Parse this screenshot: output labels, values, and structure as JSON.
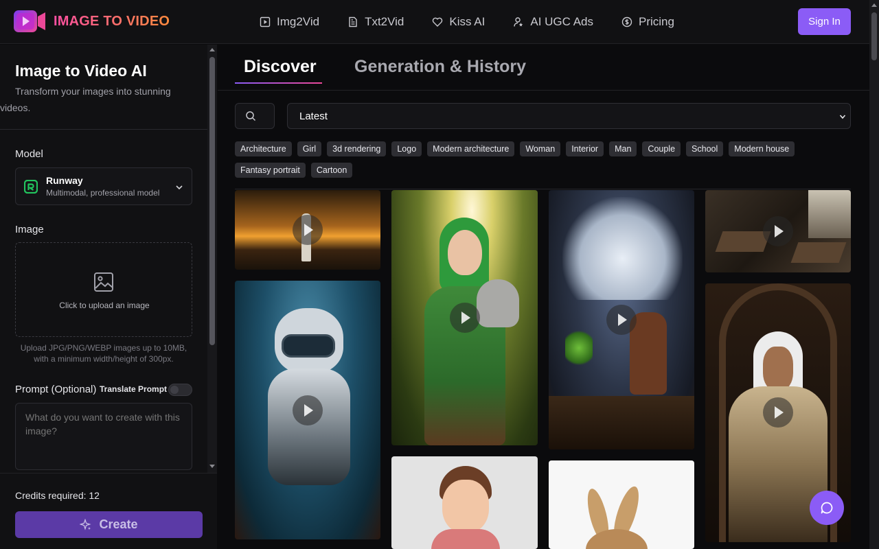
{
  "brand": {
    "name": "IMAGE TO VIDEO"
  },
  "nav": {
    "items": [
      {
        "label": "Img2Vid",
        "icon": "play-square-icon"
      },
      {
        "label": "Txt2Vid",
        "icon": "document-icon"
      },
      {
        "label": "Kiss AI",
        "icon": "heart-icon"
      },
      {
        "label": "AI UGC Ads",
        "icon": "user-star-icon"
      },
      {
        "label": "Pricing",
        "icon": "dollar-circle-icon"
      }
    ],
    "signin_label": "Sign In"
  },
  "sidebar": {
    "title": "Image to Video AI",
    "subtitle": "Transform your images into stunning videos.",
    "model_label": "Model",
    "model": {
      "name": "Runway",
      "description": "Multimodal, professional model"
    },
    "image_label": "Image",
    "upload_text": "Click to upload an image",
    "upload_hint": "Upload JPG/PNG/WEBP images up to 10MB, with a minimum width/height of 300px.",
    "prompt_label": "Prompt (Optional)",
    "translate_label": "Translate Prompt",
    "translate_on": false,
    "prompt_placeholder": "What do you want to create with this image?",
    "credits_text": "Credits required: 12",
    "create_label": "Create"
  },
  "main": {
    "tabs": [
      {
        "label": "Discover",
        "active": true
      },
      {
        "label": "Generation & History",
        "active": false
      }
    ],
    "sort_value": "Latest",
    "tags": [
      "Architecture",
      "Girl",
      "3d rendering",
      "Logo",
      "Modern architecture",
      "Woman",
      "Interior",
      "Man",
      "Couple",
      "School",
      "Modern house",
      "Fantasy portrait",
      "Cartoon"
    ]
  },
  "colors": {
    "accent": "#8b5cf6",
    "brand_gradient_start": "#ff4fa3",
    "brand_gradient_end": "#ff8a3d"
  }
}
